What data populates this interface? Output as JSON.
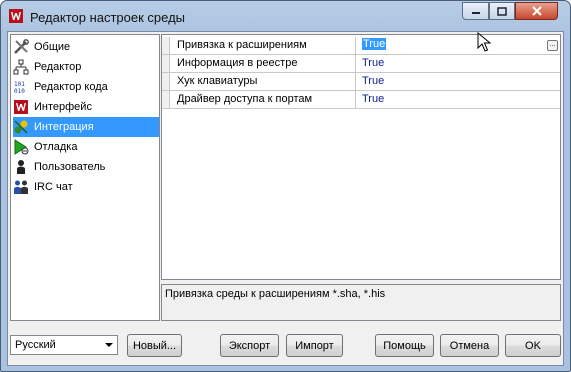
{
  "window": {
    "title": "Редактор настроек среды"
  },
  "sidebar": {
    "items": [
      {
        "label": "Общие",
        "icon": "tools-icon",
        "selected": false
      },
      {
        "label": "Редактор",
        "icon": "editor-icon",
        "selected": false
      },
      {
        "label": "Редактор кода",
        "icon": "code-editor-icon",
        "selected": false
      },
      {
        "label": "Интерфейс",
        "icon": "interface-logo-icon",
        "selected": false
      },
      {
        "label": "Интеграция",
        "icon": "integration-icon",
        "selected": true
      },
      {
        "label": "Отладка",
        "icon": "debug-play-icon",
        "selected": false
      },
      {
        "label": "Пользователь",
        "icon": "user-icon",
        "selected": false
      },
      {
        "label": "IRC чат",
        "icon": "irc-chat-icon",
        "selected": false
      }
    ]
  },
  "properties": {
    "rows": [
      {
        "name": "Привязка к расширениям",
        "value": "True"
      },
      {
        "name": "Информация в реестре",
        "value": "True"
      },
      {
        "name": "Хук клавиатуры",
        "value": "True"
      },
      {
        "name": "Драйвер доступа к портам",
        "value": "True"
      }
    ]
  },
  "description": "Привязка среды к расширениям *.sha, *.his",
  "footer": {
    "language": "Русский",
    "new_label": "Новый...",
    "export_label": "Экспорт",
    "import_label": "Импорт",
    "help_label": "Помощь",
    "cancel_label": "Отмена",
    "ok_label": "OK"
  },
  "colors": {
    "selection": "#3399ff",
    "value_text": "#0b1e8f",
    "close_button": "#c8462e"
  }
}
